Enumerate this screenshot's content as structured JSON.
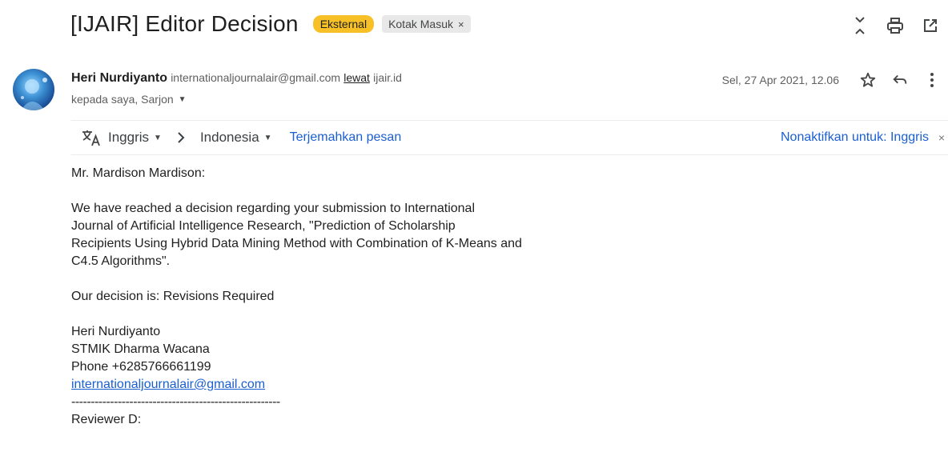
{
  "subject": {
    "title": "[IJAIR] Editor Decision",
    "chip_external": "Eksternal",
    "chip_inbox": "Kotak Masuk",
    "chip_close": "×"
  },
  "sender": {
    "name": "Heri Nurdiyanto",
    "email": "internationaljournalair@gmail.com",
    "via_label": "lewat",
    "via_domain": "ijair.id",
    "recipients": "kepada saya, Sarjon",
    "date": "Sel, 27 Apr 2021, 12.06"
  },
  "translate": {
    "from_lang": "Inggris",
    "to_lang": "Indonesia",
    "translate_link": "Terjemahkan pesan",
    "turn_off": "Nonaktifkan untuk: Inggris",
    "turn_off_close": "×"
  },
  "body": {
    "greeting": "Mr. Mardison Mardison:",
    "para1_lines": [
      "We have reached a decision regarding your submission to International",
      "Journal of Artificial Intelligence Research, \"Prediction of Scholarship",
      "Recipients Using Hybrid Data Mining Method with Combination of K-Means and",
      "C4.5 Algorithms\"."
    ],
    "decision": "Our decision is: Revisions Required",
    "signature": {
      "name": "Heri Nurdiyanto",
      "org": "STMIK Dharma Wacana",
      "phone": "Phone +6285766661199",
      "email": "internationaljournalair@gmail.com"
    },
    "divider": "------------------------------------------------------",
    "reviewer": "Reviewer D:"
  },
  "colors": {
    "accent_link": "#1a5fd1",
    "chip_external_bg": "#f6c026",
    "chip_inbox_bg": "#e8e8e8"
  }
}
